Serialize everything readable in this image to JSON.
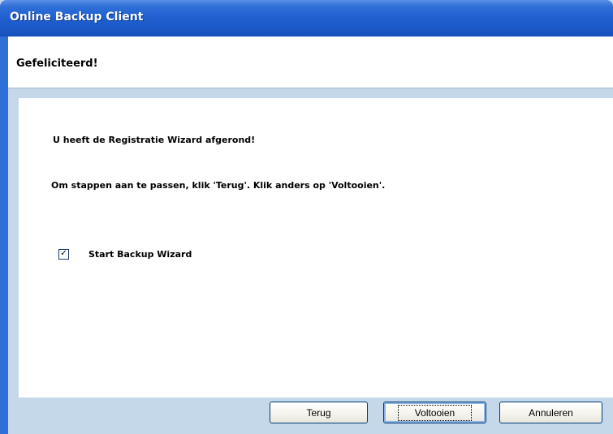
{
  "window": {
    "title": "Online Backup Client"
  },
  "header": {
    "title": "Gefeliciteerd!"
  },
  "content": {
    "message_1": "U heeft de Registratie Wizard afgerond!",
    "message_2": "Om stappen aan te passen, klik 'Terug'. Klik anders op 'Voltooien'.",
    "checkbox": {
      "label": "Start Backup Wizard",
      "checked": true,
      "mark": "☑"
    }
  },
  "footer": {
    "back_label": "Terug",
    "finish_label": "Voltooien",
    "cancel_label": "Annuleren"
  },
  "colors": {
    "title_bar": "#1f5fd0",
    "frame": "#c5d8ea",
    "button_border": "#003c74"
  }
}
